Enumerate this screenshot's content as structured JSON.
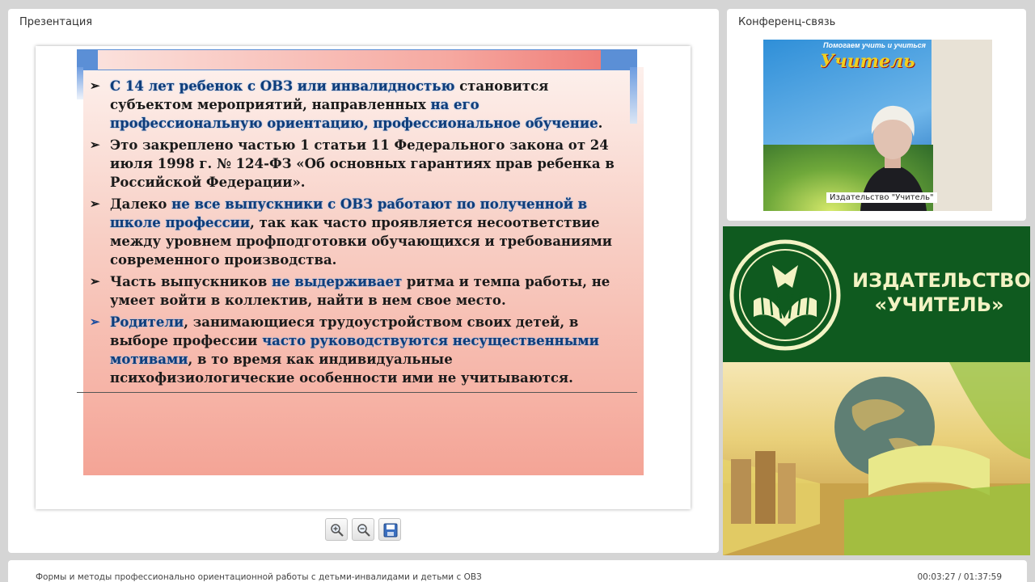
{
  "presentation_panel": {
    "title": "Презентация"
  },
  "slide": {
    "bullets": [
      {
        "arrow": "➢",
        "segments": [
          {
            "text": "С 14 лет ребенок с ОВЗ или инвалидностью",
            "hl": true
          },
          {
            "text": " становится субъектом мероприятий, направленных ",
            "hl": false
          },
          {
            "text": "на его профессиональную ориентацию, профессиональное обучение",
            "hl": true
          },
          {
            "text": ".",
            "hl": false
          }
        ]
      },
      {
        "arrow": "➢",
        "segments": [
          {
            "text": "Это закреплено частью 1 статьи 11 Федерального закона от 24 июля 1998 г. № 124-ФЗ «Об основных гарантиях прав ребенка в Российской Федерации».",
            "hl": false
          }
        ]
      },
      {
        "arrow": "➢",
        "segments": [
          {
            "text": "Далеко ",
            "hl": false
          },
          {
            "text": "не все выпускники  с ОВЗ работают по полученной в школе профессии",
            "hl": true
          },
          {
            "text": ", так как часто проявляется несоответствие между уровнем профподготовки обучающихся и требованиями современного производства.",
            "hl": false
          }
        ]
      },
      {
        "arrow": "➢",
        "segments": [
          {
            "text": "Часть выпускников ",
            "hl": false
          },
          {
            "text": "не выдерживает",
            "hl": true
          },
          {
            "text": " ритма и темпа работы, не умеет войти в коллектив, найти в нем свое место.",
            "hl": false
          }
        ]
      },
      {
        "arrow": "➢",
        "arrow_blue": true,
        "segments": [
          {
            "text": "Родители",
            "hl": true
          },
          {
            "text": ", занимающиеся трудоустройством своих детей, в выборе профессии ",
            "hl": false
          },
          {
            "text": "часто руководствуются несущественными мотивами",
            "hl": true
          },
          {
            "text": ", в то время как индивидуальные психофизиологические особенности ими не учитываются.",
            "hl": false
          }
        ]
      }
    ]
  },
  "toolbar": {
    "zoom_in_icon": "zoom-in-icon",
    "zoom_out_icon": "zoom-out-icon",
    "save_icon": "save-icon"
  },
  "conference_panel": {
    "title": "Конференц-связь",
    "video_caption": "Издательство \"Учитель\"",
    "banner_title": "Помогаем учить и учиться",
    "banner_logo": "Учитель"
  },
  "publisher": {
    "name_line1": "ИЗДАТЕЛЬСТВО",
    "name_line2": "«УЧИТЕЛЬ»"
  },
  "footer": {
    "title": "Формы и методы профессионально ориентационной работы с детьми-инвалидами и детьми с ОВЗ",
    "time": "00:03:27 / 01:37:59"
  },
  "colors": {
    "highlight_text": "#0f3d7a",
    "publisher_green": "#0f5a1f",
    "publisher_text": "#f3f3c4",
    "slide_accent_blue": "#5b8fd6"
  }
}
